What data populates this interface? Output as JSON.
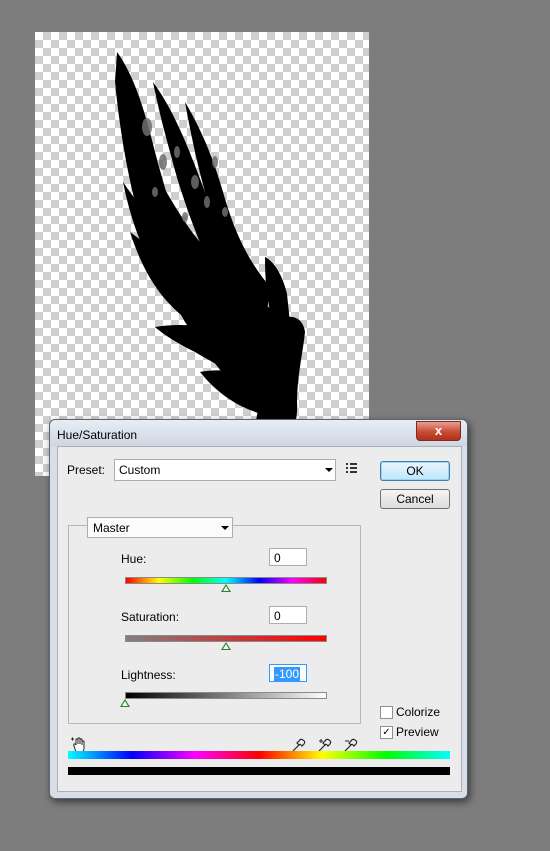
{
  "dialog": {
    "title": "Hue/Saturation",
    "close_glyph": "x",
    "preset_label": "Preset:",
    "preset_value": "Custom",
    "ok_label": "OK",
    "cancel_label": "Cancel",
    "channel_value": "Master",
    "hue": {
      "label": "Hue:",
      "value": "0"
    },
    "saturation": {
      "label": "Saturation:",
      "value": "0"
    },
    "lightness": {
      "label": "Lightness:",
      "value": "-100"
    },
    "colorize_label": "Colorize",
    "colorize_checked": false,
    "preview_label": "Preview",
    "preview_checked": true,
    "check_glyph": "✓"
  },
  "sliders": {
    "hue_level": 0.5,
    "saturation_level": 0.5,
    "lightness_level": 0.0
  },
  "icons": [
    "preset-options-icon",
    "targeted-adjustment-hand-icon",
    "eyedropper-icon",
    "eyedropper-add-icon",
    "eyedropper-subtract-icon"
  ]
}
